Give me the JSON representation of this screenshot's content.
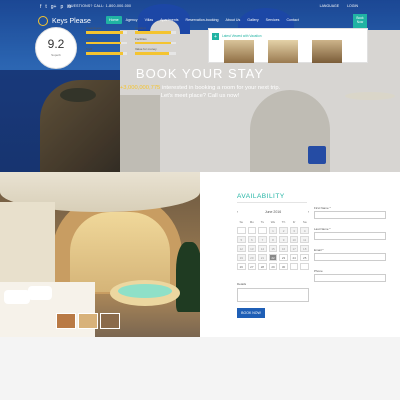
{
  "header": {
    "social": [
      "f",
      "t",
      "g+",
      "p",
      "in"
    ],
    "contact": "QUESTIONS? CALL: 1-800-000-000",
    "language": "LANGUAGE",
    "login": "LOGIN",
    "logo": "Keys Please",
    "nav": [
      "Home",
      "Agency",
      "Villas",
      "Apartments",
      "Reservation-booking",
      "About Us",
      "Gallery",
      "Services",
      "Contact"
    ],
    "book_button": "Book Now"
  },
  "hero": {
    "title": "BOOK YOUR STAY",
    "count": "+3,000,000,775",
    "line1_rest": " interested in booking a room for your next trip.",
    "line2": "Let's meet place? Call us now!"
  },
  "availability": {
    "title": "AVAILABILITY",
    "month": "June 2016",
    "prev": "‹",
    "next": "›",
    "dow": [
      "Su",
      "Mo",
      "Tu",
      "We",
      "Th",
      "Fr",
      "Sa"
    ],
    "days": [
      "",
      "",
      "",
      "1",
      "2",
      "3",
      "4",
      "5",
      "6",
      "7",
      "8",
      "9",
      "10",
      "11",
      "12",
      "13",
      "14",
      "15",
      "16",
      "17",
      "18",
      "19",
      "20",
      "21",
      "22",
      "23",
      "24",
      "25",
      "26",
      "27",
      "28",
      "29",
      "30",
      "",
      ""
    ],
    "today": "22",
    "form_labels": [
      "First Name *",
      "Last Name *",
      "Email *",
      "Phone"
    ],
    "details_label": "Details",
    "book_now": "BOOK NOW"
  },
  "reviews": {
    "score": "9.2",
    "score_label": "Superb",
    "ratings": [
      {
        "label": "Cleanliness",
        "value": 0.9
      },
      {
        "label": "Comfort",
        "value": 0.88
      },
      {
        "label": "Location",
        "value": 0.85
      },
      {
        "label": "Facilities",
        "value": 0.87
      },
      {
        "label": "Staff",
        "value": 0.9
      },
      {
        "label": "Value for money",
        "value": 0.82
      }
    ],
    "recent_title": "Latest Viewed with Vacation"
  },
  "colors": {
    "accent": "#20b3a3",
    "gold": "#f4c430",
    "primary_button": "#1f5fb6"
  }
}
